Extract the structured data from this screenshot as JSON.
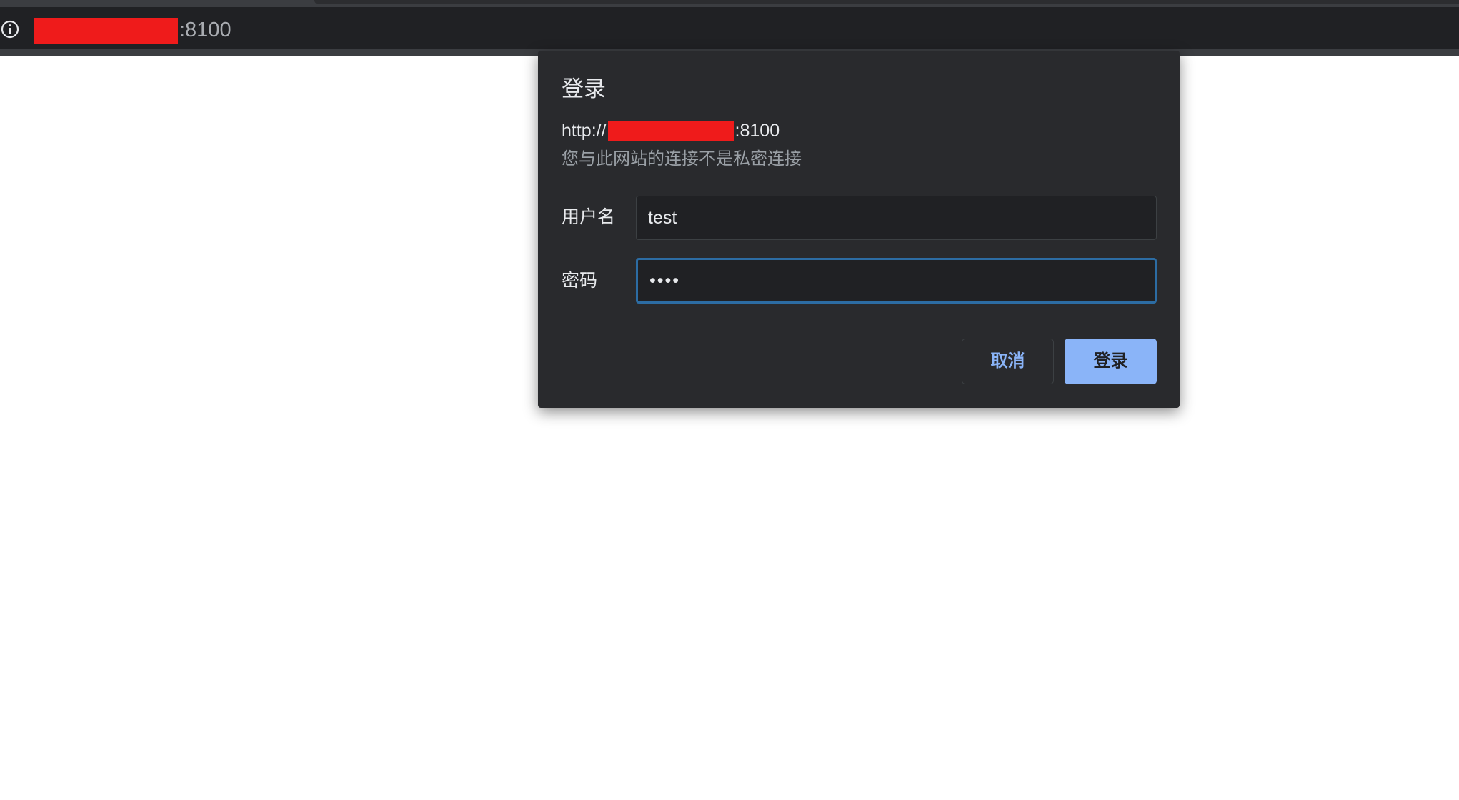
{
  "browser": {
    "address_bar": {
      "info_icon": "info-circle-icon",
      "url_port": ":8100"
    }
  },
  "dialog": {
    "title": "登录",
    "url_prefix": "http://",
    "url_suffix": ":8100",
    "connection_note": "您与此网站的连接不是私密连接",
    "username": {
      "label": "用户名",
      "value": "test"
    },
    "password": {
      "label": "密码",
      "value": "••••"
    },
    "buttons": {
      "cancel": "取消",
      "login": "登录"
    },
    "colors": {
      "accent": "#8ab4f8",
      "focus_border": "#2c6ca3",
      "redaction": "#ef1b1b"
    }
  }
}
